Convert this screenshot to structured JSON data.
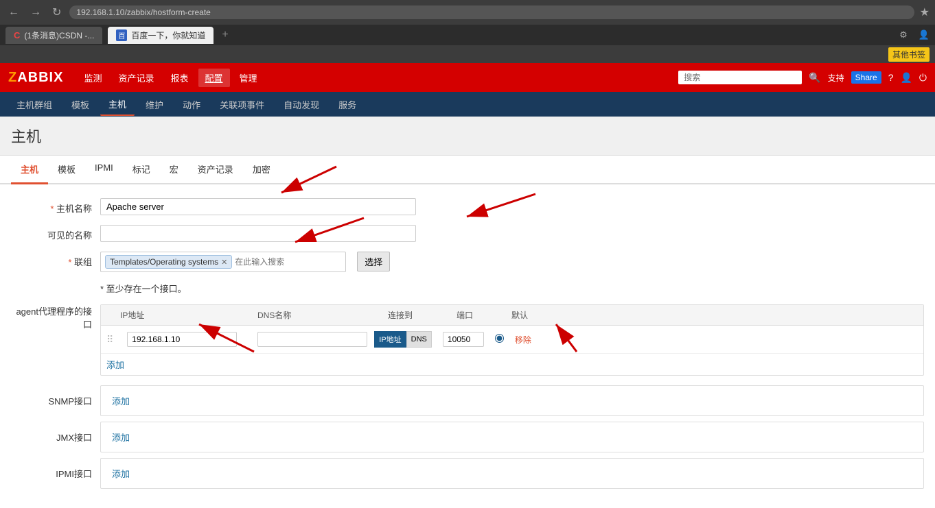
{
  "browser": {
    "tabs": [
      {
        "id": "tab1",
        "label": "(1条消息)CSDN -...",
        "icon": "C",
        "active": false
      },
      {
        "id": "tab2",
        "label": "百度一下，你就知道",
        "icon": "B",
        "active": true
      }
    ],
    "bookmark": "其他书签"
  },
  "zabbix": {
    "logo": "ZABBIX",
    "main_nav": [
      {
        "id": "monitor",
        "label": "监测",
        "active": false
      },
      {
        "id": "assets",
        "label": "资产记录",
        "active": false
      },
      {
        "id": "report",
        "label": "报表",
        "active": false
      },
      {
        "id": "config",
        "label": "配置",
        "active": true
      },
      {
        "id": "manage",
        "label": "管理",
        "active": false
      }
    ],
    "header_right": {
      "search_placeholder": "搜索",
      "support": "支持",
      "share": "Share"
    },
    "sub_nav": [
      {
        "id": "hostgroup",
        "label": "主机群组",
        "active": false
      },
      {
        "id": "template",
        "label": "模板",
        "active": false
      },
      {
        "id": "host",
        "label": "主机",
        "active": true
      },
      {
        "id": "maintenance",
        "label": "维护",
        "active": false
      },
      {
        "id": "action",
        "label": "动作",
        "active": false
      },
      {
        "id": "event",
        "label": "关联项事件",
        "active": false
      },
      {
        "id": "autodiscover",
        "label": "自动发现",
        "active": false
      },
      {
        "id": "service",
        "label": "服务",
        "active": false
      }
    ]
  },
  "page": {
    "title": "主机",
    "tabs": [
      {
        "id": "host",
        "label": "主机",
        "active": true
      },
      {
        "id": "template",
        "label": "模板",
        "active": false
      },
      {
        "id": "ipmi",
        "label": "IPMI",
        "active": false
      },
      {
        "id": "tag",
        "label": "标记",
        "active": false
      },
      {
        "id": "macro",
        "label": "宏",
        "active": false
      },
      {
        "id": "asset",
        "label": "资产记录",
        "active": false
      },
      {
        "id": "encrypt",
        "label": "加密",
        "active": false
      }
    ]
  },
  "form": {
    "hostname_label": "* 主机名称",
    "hostname_value": "Apache server",
    "visible_name_label": "可见的名称",
    "visible_name_value": "",
    "group_label": "* 联组",
    "group_tag": "Templates/Operating systems",
    "group_search_placeholder": "在此输入搜索",
    "select_btn": "选择",
    "at_least_msg": "* 至少存在一个接口。",
    "agent_label": "agent代理程序的接口",
    "interface_cols": {
      "ip": "IP地址",
      "dns": "DNS名称",
      "connect": "连接到",
      "port": "端口",
      "default": "默认"
    },
    "agent_row": {
      "ip": "192.168.1.10",
      "dns": "",
      "connect_ip": "IP地址",
      "connect_dns": "DNS",
      "port": "10050",
      "remove": "移除"
    },
    "add_label": "添加",
    "snmp_label": "SNMP接口",
    "jmx_label": "JMX接口",
    "ipmi_label": "IPMI接口",
    "snmp_add": "添加",
    "jmx_add": "添加",
    "ipmi_add": "添加"
  }
}
